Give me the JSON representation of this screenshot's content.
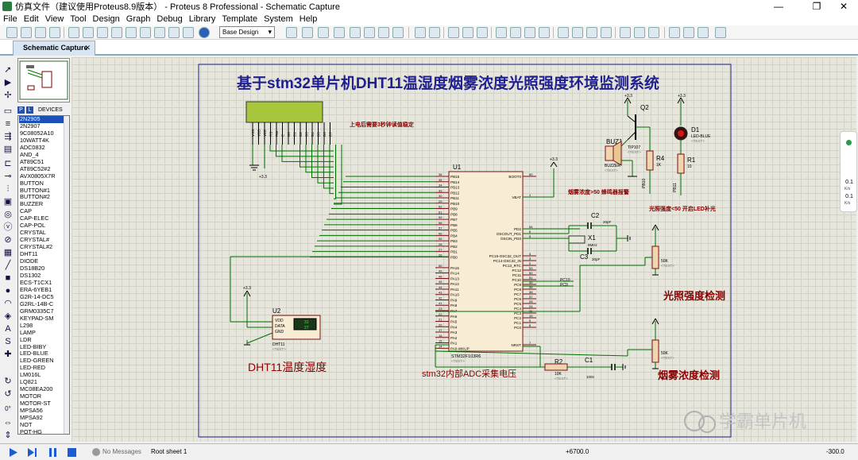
{
  "window": {
    "title": "仿真文件（建议使用Proteus8.9版本） - Proteus 8 Professional - Schematic Capture"
  },
  "menu": [
    "File",
    "Edit",
    "View",
    "Tool",
    "Design",
    "Graph",
    "Debug",
    "Library",
    "Template",
    "System",
    "Help"
  ],
  "toolbar": {
    "layer_select": "Base Design"
  },
  "tab": {
    "label": "Schematic Capture",
    "close": "✕"
  },
  "devices": {
    "header": "DEVICES",
    "p_button": "P",
    "l_button": "L",
    "items": [
      "2N2905",
      "2N2907",
      "9C08052A10",
      "10WATT4K",
      "ADC0832",
      "AND_4",
      "AT89C51",
      "AT89C52#2",
      "AVX0805X7R",
      "BUTTON",
      "BUTTON#1",
      "BUTTON#2",
      "BUZZER",
      "CAP",
      "CAP-ELEC",
      "CAP-POL",
      "CRYSTAL",
      "CRYSTAL#",
      "CRYSTAL#2",
      "DHT11",
      "DIODE",
      "DS18B20",
      "DS1302",
      "ECS-T1CX1",
      "ERA-6YEB1",
      "G2R-14-DC5",
      "G2RL-14B-C",
      "GRM0335C7",
      "KEYPAD-SM",
      "L298",
      "LAMP",
      "LDR",
      "LED-BIBY",
      "LED-BLUE",
      "LED-GREEN",
      "LED-RED",
      "LM016L",
      "LQ821",
      "MC08EA200",
      "MOTOR",
      "MOTOR-ST",
      "MPSA56",
      "MPSA92",
      "NOT",
      "POT-HG"
    ],
    "selected_index": 0
  },
  "schematic": {
    "title": "基于stm32单片机DHT11温湿度烟雾浓度光照强度环境监测系统",
    "note_lcd": "上电后需要3秒钟读值稳定",
    "note_buzzer": "烟雾浓度>50  蜂鸣器报警",
    "note_led": "光照强度<50  开启LED补光",
    "label_light": "光照强度检测",
    "label_smoke": "烟雾浓度检测",
    "label_dht": "DHT11温度湿度",
    "label_adc": "stm32内部ADC采集电压",
    "mcu_ref": "U1",
    "mcu_part": "STM32F103R6",
    "mcu_left_pins": [
      "PB15",
      "PB14",
      "PB13",
      "PB12",
      "PB11",
      "PB10",
      "PB9",
      "PB8",
      "PB7",
      "PB6",
      "PB5",
      "PB4",
      "PB3",
      "PB2",
      "PB1",
      "PB0",
      "",
      "PA15",
      "PA14",
      "PA13",
      "PA12",
      "PA11",
      "PA10",
      "PA9",
      "PA8",
      "PA7",
      "PA6",
      "PA5",
      "PA4",
      "PA3",
      "PA2",
      "PA1",
      "PA0-WKUP"
    ],
    "mcu_left_nums": [
      "36",
      "35",
      "34",
      "33",
      "30",
      "29",
      "62",
      "61",
      "59",
      "58",
      "57",
      "56",
      "55",
      "28",
      "27",
      "26",
      "",
      "50",
      "49",
      "46",
      "45",
      "44",
      "43",
      "42",
      "41",
      "23",
      "22",
      "21",
      "20",
      "17",
      "16",
      "15",
      "14"
    ],
    "mcu_right_pins": [
      "BOOT0",
      "VBAT",
      "PD2",
      "OSCOUT_PD1",
      "OSCIN_PD0",
      "PC15-OSC32_OUT",
      "PC14-OSC32_IN",
      "PC13_RTC",
      "PC12",
      "PC11",
      "PC10",
      "PC9",
      "PC8",
      "PC7",
      "PC6",
      "PC5",
      "PC4",
      "PC3",
      "PC2",
      "PC1",
      "PC0",
      "NRST"
    ],
    "mcu_right_nums": [
      "60",
      "1",
      "54",
      "6",
      "5",
      "4",
      "3",
      "2",
      "53",
      "52",
      "51",
      "40",
      "39",
      "38",
      "37",
      "25",
      "24",
      "11",
      "10",
      "9",
      "8",
      "7"
    ],
    "lcd_pins": [
      "VSS",
      "VDD",
      "VEE",
      "RS",
      "RW",
      "E",
      "D0",
      "D1",
      "D2",
      "D3",
      "D4",
      "D5",
      "D6",
      "D7"
    ],
    "power": "+3.3",
    "q2": "Q2",
    "q2_part": "TIP107",
    "buz": "BUZ1",
    "buz_part": "BUZZER",
    "r4": "R4",
    "r4_val": "1K",
    "r1": "R1",
    "r1_val": "10",
    "d1": "D1",
    "d1_part": "LED-BLUE",
    "c2": "C2",
    "c2_val": "20pF",
    "c3": "C3",
    "c3_val": "20pF",
    "x1": "X1",
    "x1_val": "8MHz",
    "rv_val": "50K",
    "r2": "R2",
    "r2_val": "10K",
    "c1": "C1",
    "c1_val": "100n",
    "u2": "U2",
    "u2_part": "DHT11",
    "u2_pins": [
      "VDD",
      "DATA",
      "GND"
    ],
    "u2_disp1": "31",
    "u2_disp2": "27",
    "pc10": "PC10",
    "pc9": "PC9",
    "pa10": "PA10",
    "pb0": "PB0",
    "text_tag": "<TEXT>"
  },
  "side_widget": {
    "v1": "0.1",
    "u1": "K/s",
    "v2": "0.1",
    "u2": "K/s"
  },
  "watermark": "学霸单片机",
  "status": {
    "messages": "No Messages",
    "sheet": "Root sheet 1",
    "x": "+6700.0",
    "y": "-300.0"
  }
}
